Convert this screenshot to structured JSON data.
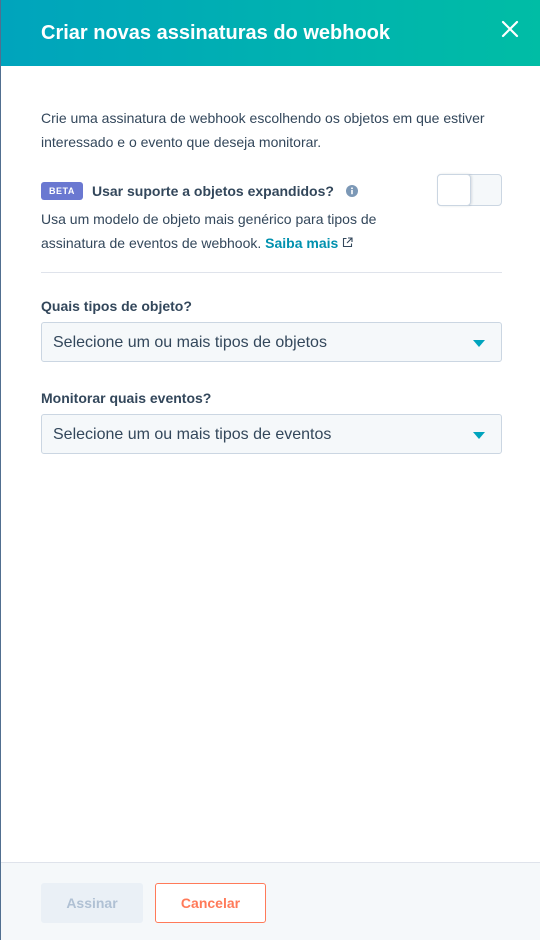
{
  "header": {
    "title": "Criar novas assinaturas do webhook",
    "close_icon": "close-icon"
  },
  "intro": {
    "text": "Crie uma assinatura de webhook escolhendo os objetos em que estiver interessado e o evento que deseja monitorar."
  },
  "expanded_objects": {
    "badge": "BETA",
    "label": "Usar suporte a objetos expandidos?",
    "info_icon": "info-icon",
    "toggle_on": false,
    "description": "Usa um modelo de objeto mais genérico para tipos de assinatura de eventos de webhook. ",
    "learn_more": "Saiba mais",
    "learn_more_icon": "external-link-icon"
  },
  "object_types": {
    "label": "Quais tipos de objeto?",
    "placeholder": "Selecione um ou mais tipos de objetos"
  },
  "events": {
    "label": "Monitorar quais eventos?",
    "placeholder": "Selecione um ou mais tipos de eventos"
  },
  "footer": {
    "submit_label": "Assinar",
    "cancel_label": "Cancelar"
  },
  "colors": {
    "header_gradient_start": "#00a4bd",
    "header_gradient_end": "#00bda5",
    "text": "#33475b",
    "link": "#0091ae",
    "beta_badge": "#6a78d1",
    "cancel_accent": "#ff7a59",
    "disabled_button_bg": "#eaf0f6"
  }
}
